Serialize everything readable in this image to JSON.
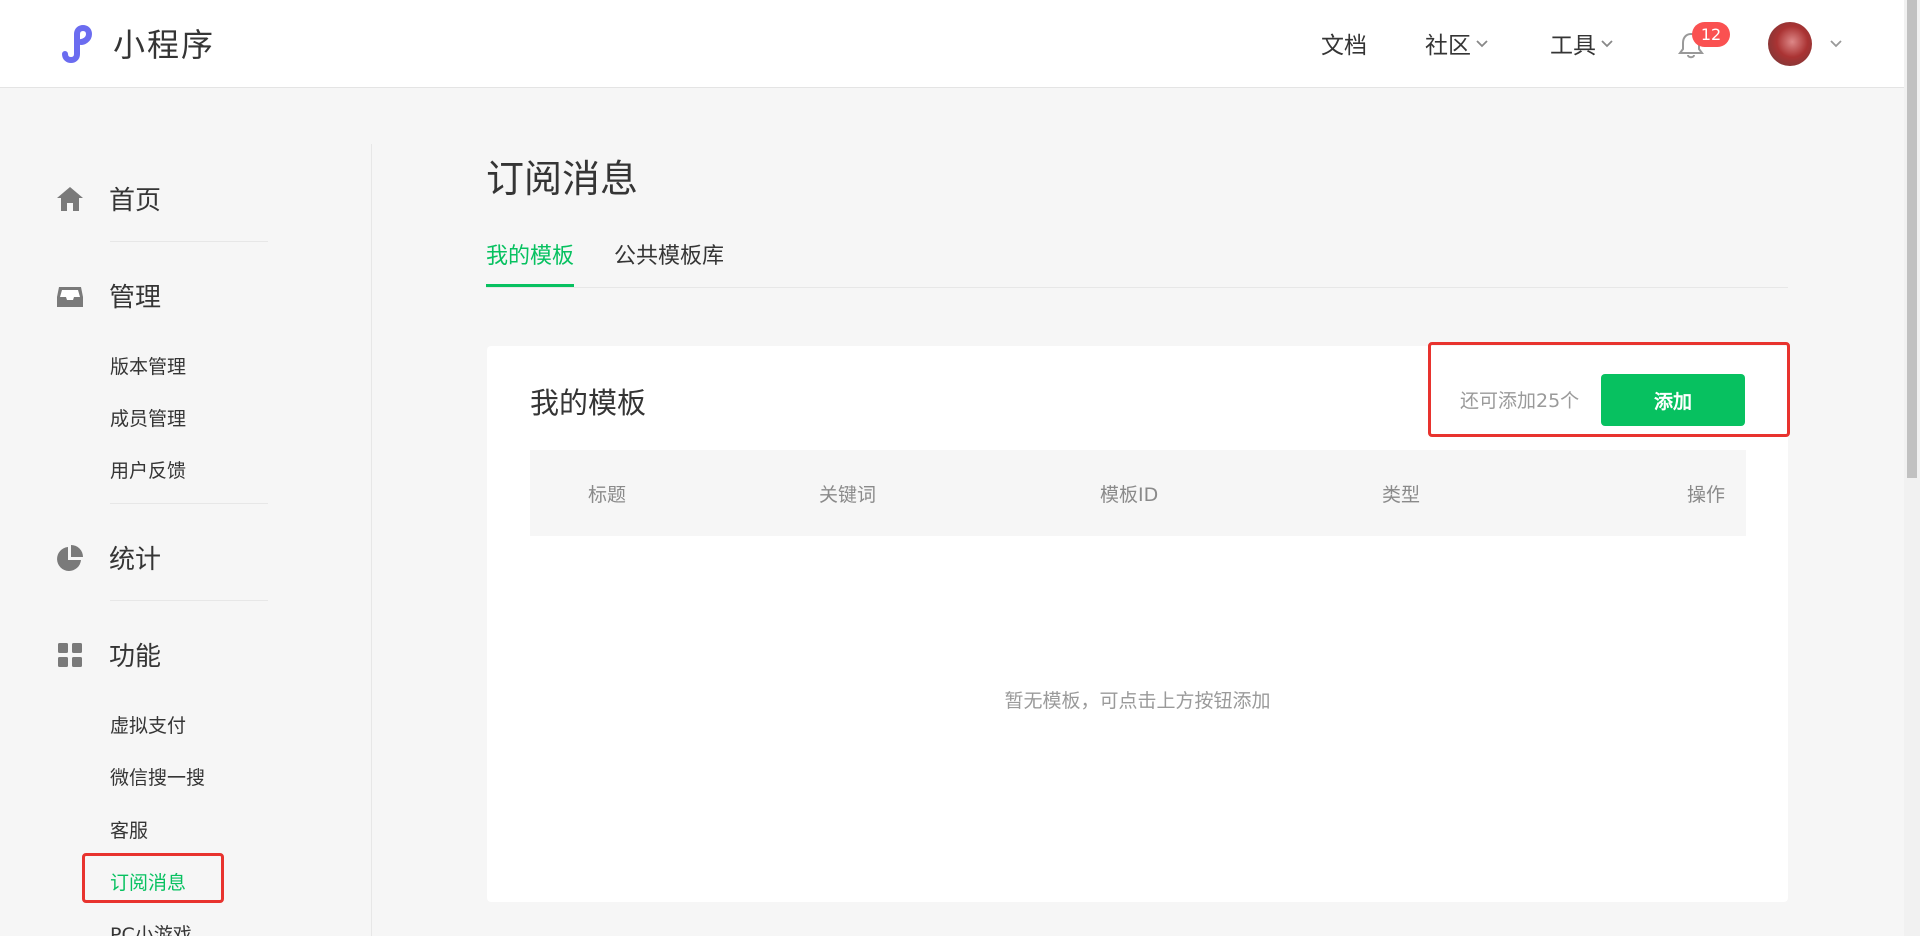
{
  "header": {
    "logo_text": "小程序",
    "nav": [
      {
        "label": "文档",
        "has_dropdown": false
      },
      {
        "label": "社区",
        "has_dropdown": true
      },
      {
        "label": "工具",
        "has_dropdown": true
      }
    ],
    "notification_count": "12"
  },
  "sidebar": {
    "sections": [
      {
        "label": "首页",
        "icon": "home-icon"
      },
      {
        "label": "管理",
        "icon": "inbox-icon"
      },
      {
        "label": "统计",
        "icon": "pie-chart-icon"
      },
      {
        "label": "功能",
        "icon": "grid-icon"
      }
    ],
    "manage_items": [
      "版本管理",
      "成员管理",
      "用户反馈"
    ],
    "feature_items": [
      "虚拟支付",
      "微信搜一搜",
      "客服",
      "订阅消息",
      "PC小游戏"
    ],
    "active_item": "订阅消息"
  },
  "main": {
    "title": "订阅消息",
    "tabs": [
      {
        "label": "我的模板",
        "active": true
      },
      {
        "label": "公共模板库",
        "active": false
      }
    ],
    "card": {
      "title": "我的模板",
      "remaining_text": "还可添加25个",
      "add_button": "添加",
      "columns": [
        "标题",
        "关键词",
        "模板ID",
        "类型",
        "操作"
      ],
      "rows": [],
      "empty_text": "暂无模板，可点击上方按钮添加"
    }
  },
  "colors": {
    "accent": "#07c160",
    "highlight": "#e8332e",
    "badge": "#fa5151"
  }
}
